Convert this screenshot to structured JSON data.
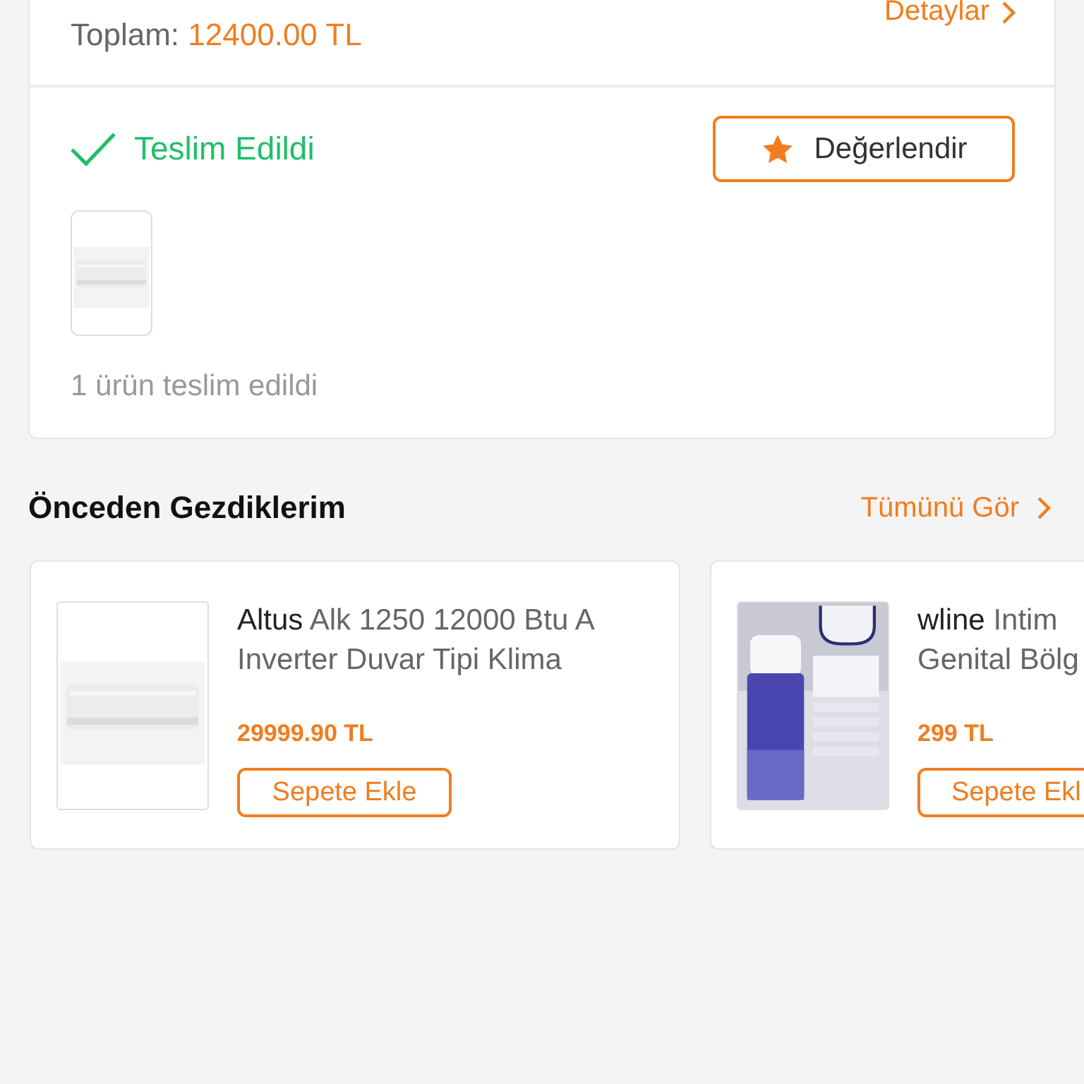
{
  "order": {
    "details_link": "Detaylar",
    "total_label": "Toplam:",
    "total_value": "12400.00 TL",
    "status": {
      "kind": "delivered",
      "label": "Teslim Edildi"
    },
    "rate_button": "Değerlendir",
    "summary": "1 ürün teslim edildi"
  },
  "recently_viewed": {
    "title": "Önceden Gezdiklerim",
    "see_all": "Tümünü Gör",
    "products": [
      {
        "name": "**Altus** Alk 1250 12000 Btu A Inverter Duvar Tipi Klima",
        "price": "29999.90 TL",
        "button": "Sepete Ekle",
        "kind": "picture"
      },
      {
        "name": "**wline** Intim Genital Bölg",
        "price": "299 TL",
        "button": "Sepete Ekl",
        "kind": "picture"
      }
    ]
  }
}
